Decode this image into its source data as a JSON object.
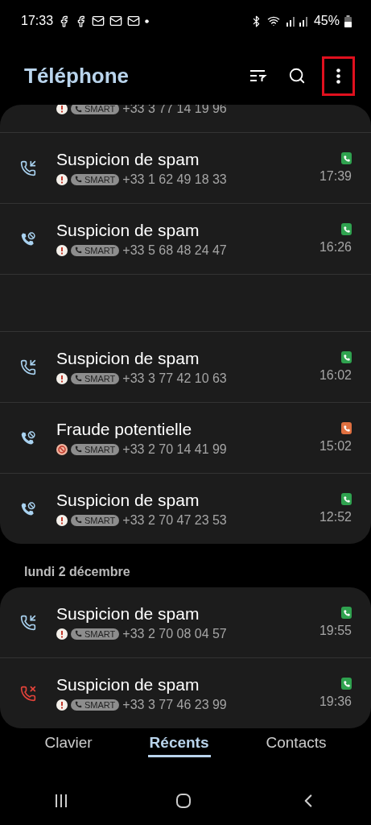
{
  "status_bar": {
    "time": "17:33",
    "battery": "45%"
  },
  "header": {
    "title": "Téléphone",
    "menu_highlighted": true
  },
  "sections": [
    {
      "calls": [
        {
          "kind": "partial",
          "fraud": false,
          "tag": "SMART",
          "number": "+33 3 77 14 19 96"
        },
        {
          "kind": "incoming",
          "name": "Suspicion de spam",
          "fraud": false,
          "tag": "SMART",
          "number": "+33 1 62 49 18 33",
          "time": "17:39",
          "color": "#2fa24f"
        },
        {
          "kind": "blocked",
          "name": "Suspicion de spam",
          "fraud": false,
          "tag": "SMART",
          "number": "+33 5 68 48 24 47",
          "time": "16:26",
          "color": "#2fa24f"
        },
        {
          "kind": "blank"
        },
        {
          "kind": "incoming",
          "name": "Suspicion de spam",
          "fraud": false,
          "tag": "SMART",
          "number": "+33 3 77 42 10 63",
          "time": "16:02",
          "color": "#2fa24f"
        },
        {
          "kind": "blocked",
          "name": "Fraude potentielle",
          "fraud": true,
          "tag": "SMART",
          "number": "+33 2 70 14 41 99",
          "time": "15:02",
          "color": "#e07040"
        },
        {
          "kind": "blocked",
          "name": "Suspicion de spam",
          "fraud": false,
          "tag": "SMART",
          "number": "+33 2 70 47 23 53",
          "time": "12:52",
          "color": "#2fa24f"
        }
      ]
    },
    {
      "date": "lundi 2 décembre",
      "calls": [
        {
          "kind": "incoming",
          "name": "Suspicion de spam",
          "fraud": false,
          "tag": "SMART",
          "number": "+33 2 70 08 04 57",
          "time": "19:55",
          "color": "#2fa24f"
        },
        {
          "kind": "missed",
          "name": "Suspicion de spam",
          "fraud": false,
          "tag": "SMART",
          "number": "+33 3 77 46 23 99",
          "time": "19:36",
          "color": "#2fa24f"
        }
      ]
    }
  ],
  "tabs": [
    {
      "label": "Clavier",
      "selected": false
    },
    {
      "label": "Récents",
      "selected": true
    },
    {
      "label": "Contacts",
      "selected": false
    }
  ]
}
